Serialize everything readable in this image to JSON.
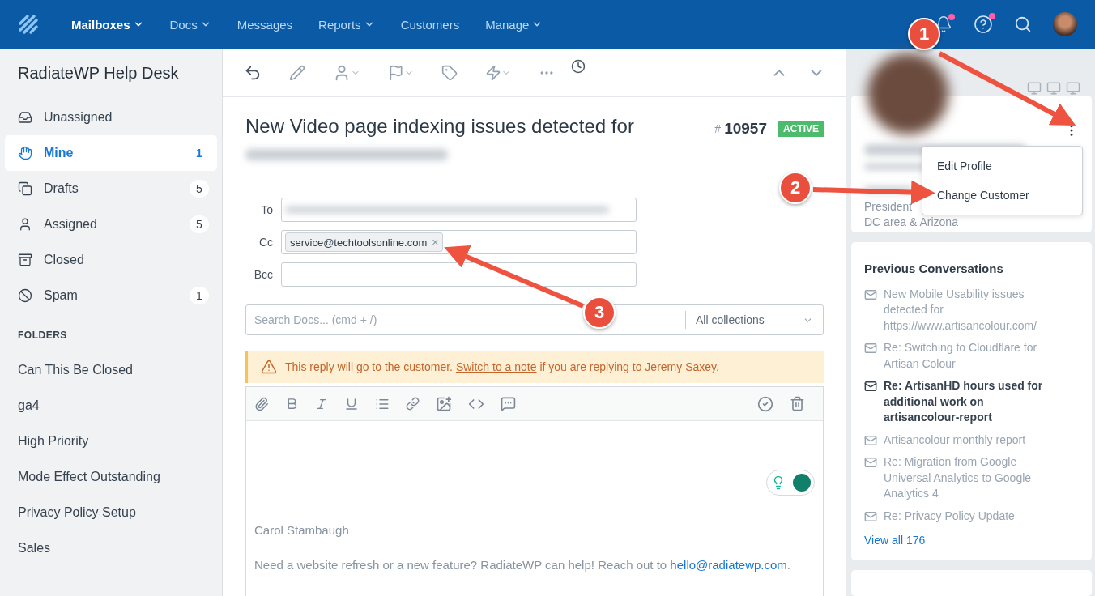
{
  "top_nav": {
    "items": [
      {
        "label": "Mailboxes",
        "has_menu": true,
        "selected": true
      },
      {
        "label": "Docs",
        "has_menu": true,
        "selected": false
      },
      {
        "label": "Messages",
        "has_menu": false,
        "selected": false
      },
      {
        "label": "Reports",
        "has_menu": true,
        "selected": false
      },
      {
        "label": "Customers",
        "has_menu": false,
        "selected": false
      },
      {
        "label": "Manage",
        "has_menu": true,
        "selected": false
      }
    ],
    "notification_dots": {
      "alerts": true,
      "help": true
    }
  },
  "sidebar": {
    "title": "RadiateWP Help Desk",
    "mailboxes": [
      {
        "label": "Unassigned",
        "selected": false
      },
      {
        "label": "Mine",
        "count": "1",
        "selected": true
      },
      {
        "label": "Drafts",
        "count": "5",
        "selected": false
      },
      {
        "label": "Assigned",
        "count": "5",
        "selected": false
      },
      {
        "label": "Closed",
        "selected": false
      },
      {
        "label": "Spam",
        "count": "1",
        "selected": false
      }
    ],
    "folders_heading": "FOLDERS",
    "folders": [
      "Can This Be Closed",
      "ga4",
      "High Priority",
      "Mode Effect Outstanding",
      "Privacy Policy Setup",
      "Sales"
    ]
  },
  "conversation": {
    "title": "New Video page indexing issues detected for",
    "number_prefix": "#",
    "number": "10957",
    "status": "ACTIVE",
    "fields": [
      {
        "label": "To",
        "kind": "redacted"
      },
      {
        "label": "Cc",
        "kind": "tags",
        "tags": [
          {
            "text": "service@techtoolsonline.com",
            "remove": "×"
          }
        ]
      },
      {
        "label": "Bcc",
        "kind": "empty"
      }
    ],
    "docs_search": {
      "placeholder": "Search Docs... (cmd + /)",
      "collection": "All collections"
    },
    "warning": {
      "before": "This reply will go to the customer. ",
      "link": "Switch to a note",
      "after": " if you are replying to Jeremy Saxey."
    },
    "signature_name": "Carol Stambaugh",
    "signature_line": {
      "before": "Need a website refresh or a new feature? RadiateWP can help! Reach out to ",
      "link": "hello@radiatewp.com",
      "after": "."
    }
  },
  "customer": {
    "menu": [
      "Edit Profile",
      "Change Customer"
    ],
    "title": "President",
    "location": "DC area & Arizona"
  },
  "previous_conversations": {
    "heading": "Previous Conversations",
    "items": [
      {
        "text": "New Mobile Usability issues detected for https://www.artisancolour.com/",
        "unread": false
      },
      {
        "text": "Re: Switching to Cloudflare for Artisan Colour",
        "unread": false
      },
      {
        "text": "Re: ArtisanHD hours used for additional work on artisancolour-report",
        "unread": true
      },
      {
        "text": "Artisancolour monthly report",
        "unread": false
      },
      {
        "text": "Re: Migration from Google Universal Analytics to Google Analytics 4",
        "unread": false
      },
      {
        "text": "Re: Privacy Policy Update",
        "unread": false
      }
    ],
    "view_all": "View all 176"
  },
  "annotations": [
    {
      "number": "1"
    },
    {
      "number": "2"
    },
    {
      "number": "3"
    }
  ]
}
